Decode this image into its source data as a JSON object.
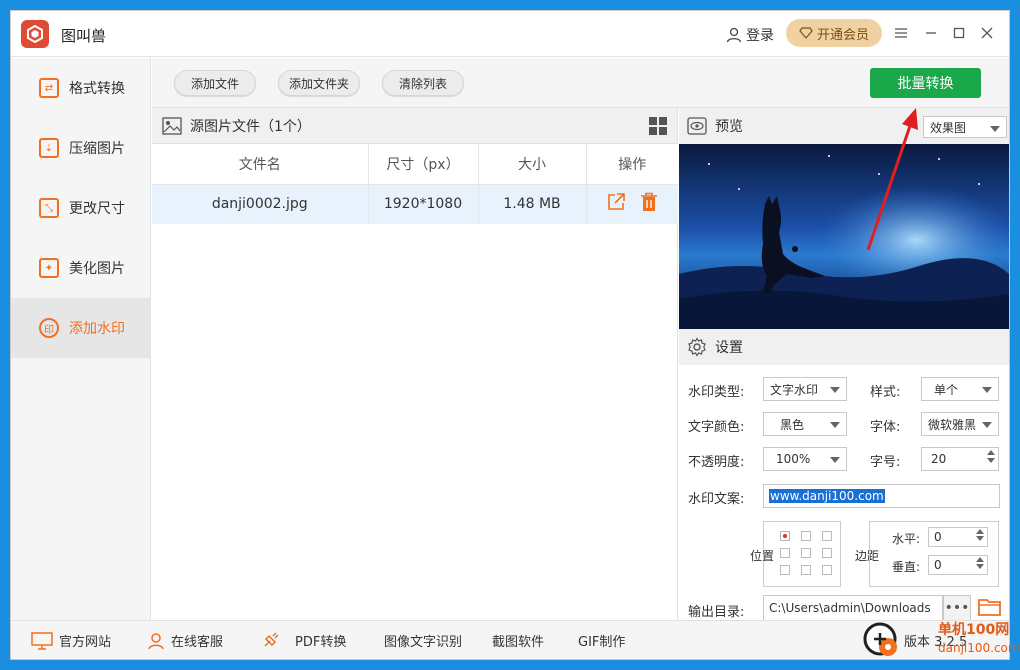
{
  "app": {
    "title": "图叫兽"
  },
  "header": {
    "login": "登录",
    "vip": "开通会员"
  },
  "sidebar": {
    "items": [
      {
        "label": "格式转换",
        "icon": "swap-icon"
      },
      {
        "label": "压缩图片",
        "icon": "compress-icon"
      },
      {
        "label": "更改尺寸",
        "icon": "resize-icon"
      },
      {
        "label": "美化图片",
        "icon": "beautify-icon"
      },
      {
        "label": "添加水印",
        "icon": "stamp-icon",
        "active": true
      }
    ]
  },
  "toolbar": {
    "add_file": "添加文件",
    "add_folder": "添加文件夹",
    "clear_list": "清除列表",
    "batch_convert": "批量转换"
  },
  "files": {
    "header": "源图片文件（1个）",
    "columns": [
      "文件名",
      "尺寸（px）",
      "大小",
      "操作"
    ],
    "rows": [
      {
        "name": "danji0002.jpg",
        "size_px": "1920*1080",
        "size": "1.48 MB"
      }
    ]
  },
  "preview": {
    "label": "预览",
    "mode": "效果图"
  },
  "settings": {
    "label": "设置",
    "watermark_type_label": "水印类型:",
    "watermark_type": "文字水印",
    "style_label": "样式:",
    "style": "单个",
    "text_color_label": "文字颜色:",
    "text_color": "黑色",
    "font_label": "字体:",
    "font": "微软雅黑",
    "opacity_label": "不透明度:",
    "opacity": "100%",
    "font_size_label": "字号:",
    "font_size": "20",
    "text_label": "水印文案:",
    "text": "www.danji100.com",
    "position_label": "位置",
    "margin_label": "边距",
    "horizontal_label": "水平:",
    "horizontal": "0",
    "vertical_label": "垂直:",
    "vertical": "0",
    "output_label": "输出目录:",
    "output_path": "C:\\Users\\admin\\Downloads"
  },
  "bottombar": {
    "website": "官方网站",
    "support": "在线客服",
    "pdf": "PDF转换",
    "ocr": "图像文字识别",
    "screenshot": "截图软件",
    "gif": "GIF制作",
    "version": "版本 3.2.5"
  },
  "watermark": {
    "site": "单机100网",
    "url": "danji100.com"
  },
  "colors": {
    "accent": "#f07020",
    "batch": "#1aa84a",
    "arrow": "#e02020",
    "titlebar_bg": "#ffffff"
  }
}
